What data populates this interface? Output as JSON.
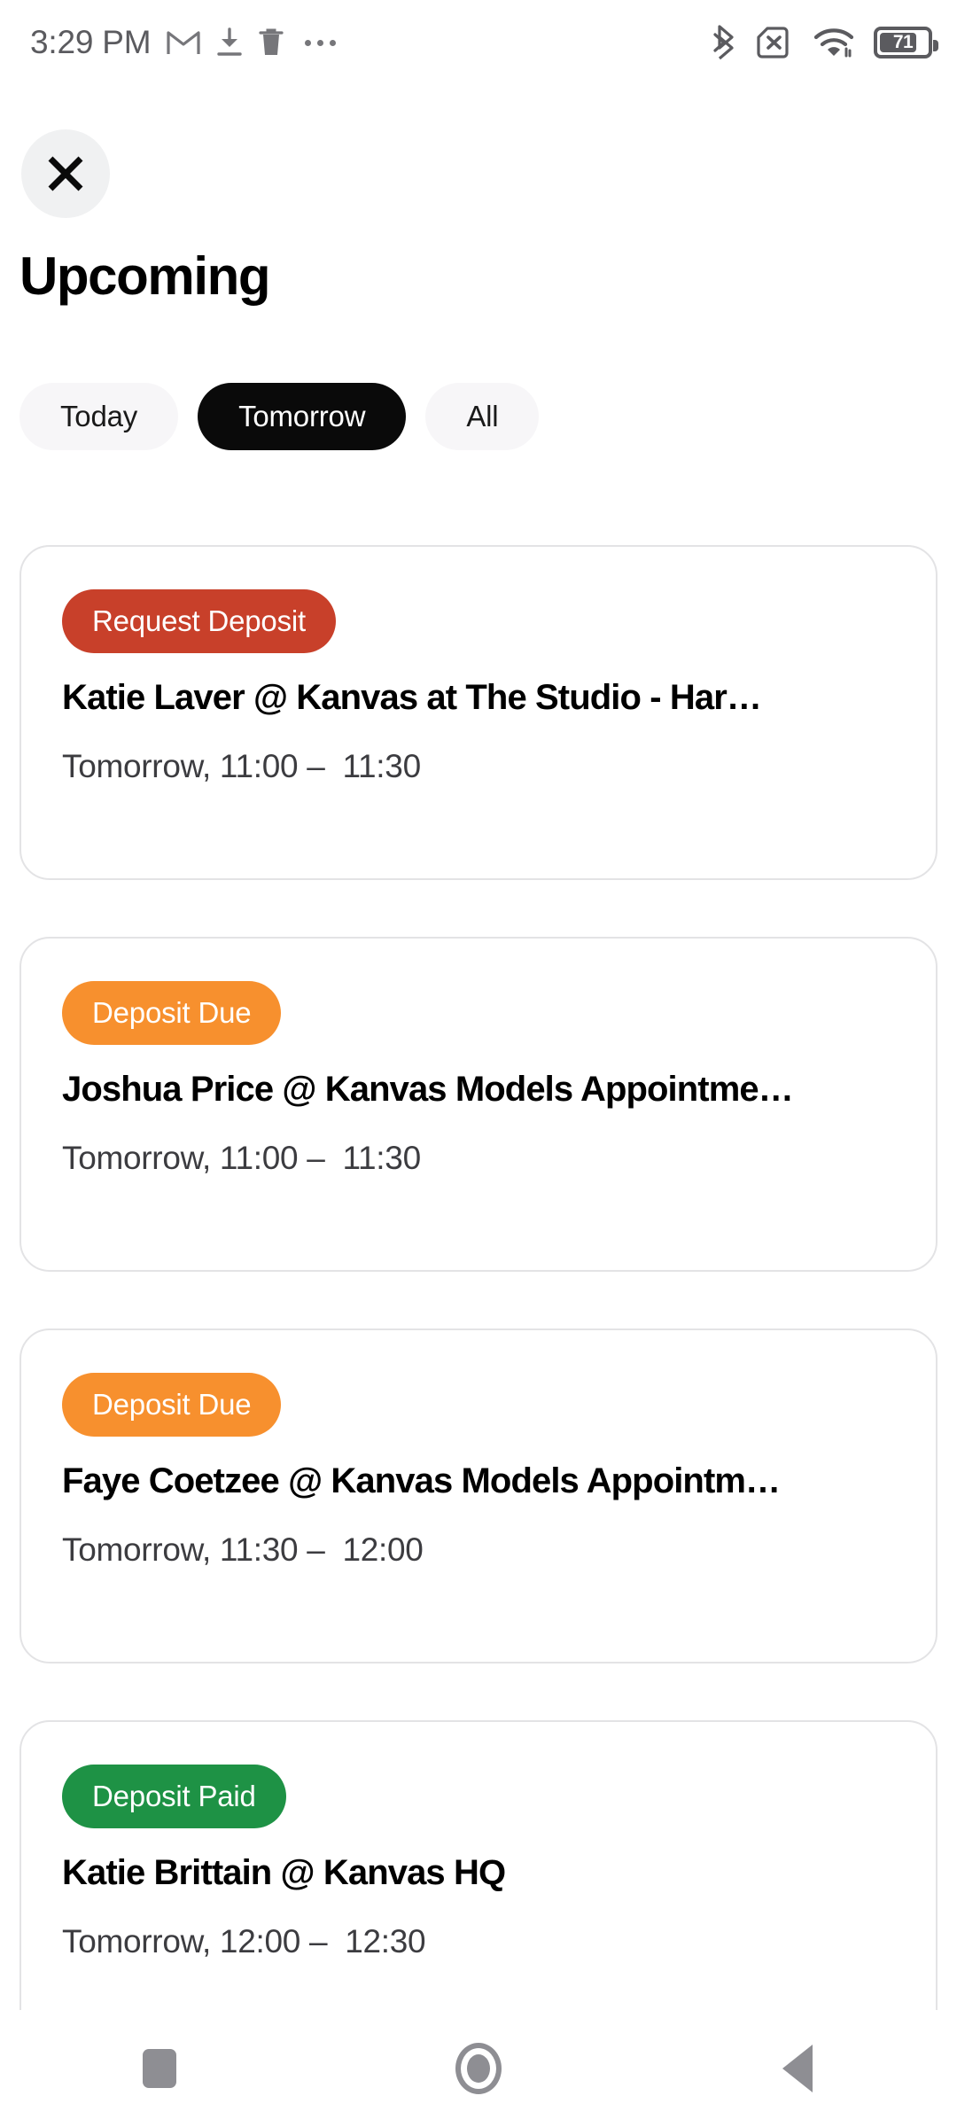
{
  "status_bar": {
    "clock": "3:29 PM",
    "left_icons": [
      "gmail-icon",
      "download-icon",
      "trash-icon",
      "overflow-dots-icon"
    ],
    "right_icons": [
      "bluetooth-icon",
      "no-sim-icon",
      "wifi-icon",
      "battery-icon"
    ],
    "battery_percent": "71"
  },
  "header": {
    "close_icon": "close-icon",
    "title": "Upcoming"
  },
  "filters": {
    "items": [
      {
        "label": "Today",
        "active": false
      },
      {
        "label": "Tomorrow",
        "active": true
      },
      {
        "label": "All",
        "active": false
      }
    ]
  },
  "colors": {
    "request_deposit": "#c8402a",
    "deposit_due": "#f7902e",
    "deposit_paid": "#1e9245",
    "active_pill": "#0a0a0a",
    "inactive_pill": "#f7f6f8",
    "card_border": "#e3e3e5",
    "time_text": "#3c3c40",
    "nav_icon": "#8e8e93"
  },
  "appointments": [
    {
      "badge": "Request Deposit",
      "badge_color": "#c8402a",
      "title": "Katie   Laver @ Kanvas at The Studio - Har…",
      "time": "Tomorrow, 11:00 –  11:30"
    },
    {
      "badge": "Deposit Due",
      "badge_color": "#f7902e",
      "title": "Joshua Price @ Kanvas Models Appointme…",
      "time": "Tomorrow, 11:00 –  11:30"
    },
    {
      "badge": "Deposit Due",
      "badge_color": "#f7902e",
      "title": "Faye  Coetzee @ Kanvas Models Appointm…",
      "time": "Tomorrow, 11:30 –  12:00"
    },
    {
      "badge": "Deposit Paid",
      "badge_color": "#1e9245",
      "title": "Katie Brittain @ Kanvas HQ",
      "time": "Tomorrow, 12:00 –  12:30"
    }
  ],
  "nav_bar": {
    "recents_icon": "square-recents-icon",
    "home_icon": "circle-home-icon",
    "back_icon": "triangle-back-icon"
  }
}
